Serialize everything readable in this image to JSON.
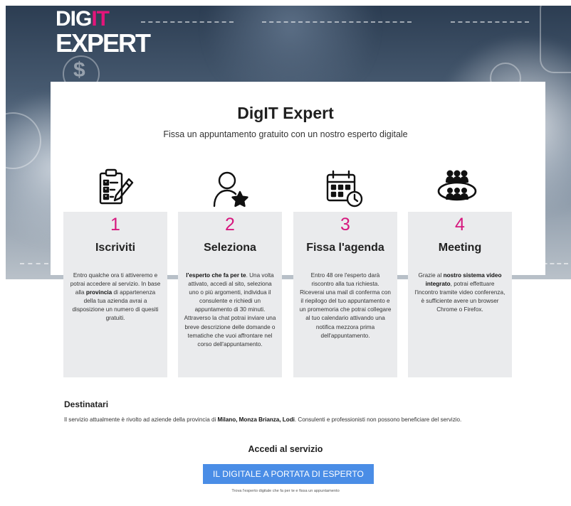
{
  "logo": {
    "line1_a": "DIG",
    "line1_b": "IT",
    "line2": "EXPERT"
  },
  "header": {
    "title": "DigIT Expert",
    "subtitle": "Fissa un appuntamento gratuito con un nostro esperto digitale"
  },
  "icons": [
    "clipboard-checklist-icon",
    "user-star-icon",
    "calendar-clock-icon",
    "meeting-group-icon"
  ],
  "steps": [
    {
      "number": "1",
      "name": "Iscriviti",
      "desc_a": "Entro qualche ora ti attiveremo e potrai accedere al servizio. In base alla ",
      "desc_b": "provincia",
      "desc_c": " di appartenenza della tua azienda avrai a disposizione un numero di quesiti gratuiti."
    },
    {
      "number": "2",
      "name": "Seleziona",
      "desc_a": "",
      "desc_b": "l'esperto che fa per te",
      "desc_c": ". Una volta attivato, accedi al sito, seleziona uno o più argomenti, individua il consulente e richiedi un appuntamento di 30 minuti. Attraverso la chat potrai inviare una breve descrizione delle domande o tematiche che vuoi affrontare nel corso dell'appuntamento."
    },
    {
      "number": "3",
      "name": "Fissa l'agenda",
      "desc_a": "Entro 48 ore l'esperto darà riscontro alla tua richiesta. Riceverai una mail di conferma con il riepilogo del tuo appuntamento e un promemoria che potrai collegare al tuo calendario attivando una notifica mezzora prima dell'appuntamento.",
      "desc_b": "",
      "desc_c": ""
    },
    {
      "number": "4",
      "name": "Meeting",
      "desc_a": "Grazie al ",
      "desc_b": "nostro sistema video integrato",
      "desc_c": ", potrai effettuare l'incontro tramite video conferenza, è sufficiente avere un browser Chrome o Firefox."
    }
  ],
  "recipients": {
    "heading": "Destinatari",
    "text_a": "Il servizio attualmente è rivolto ad aziende della provincia di ",
    "text_b": "Milano, Monza Brianza, Lodi",
    "text_c": ". Consulenti e professionisti non possono beneficiare del servizio."
  },
  "access": {
    "heading": "Accedi al servizio",
    "button_label": "IL DIGITALE A PORTATA DI ESPERTO",
    "note": "Trova l'esperto digitale che fa per te e fissa un appuntamento"
  },
  "colors": {
    "accent_pink": "#d6187e",
    "button_blue": "#4a8de6",
    "step_bg": "#eaebed"
  }
}
